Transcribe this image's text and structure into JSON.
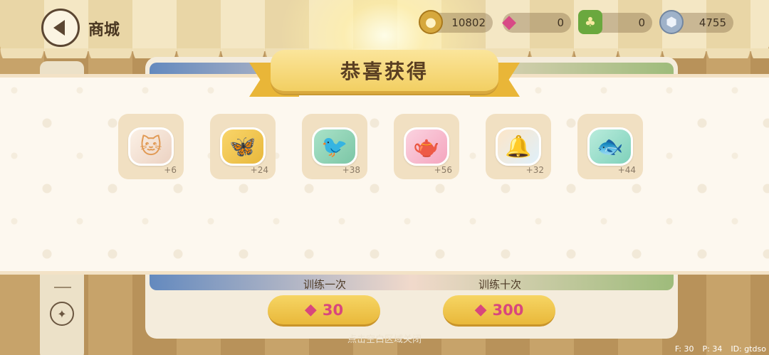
{
  "header": {
    "title": "商城",
    "back_icon": "back-arrow-icon"
  },
  "currencies": [
    {
      "name": "coin",
      "icon": "coin-icon",
      "value": "10802"
    },
    {
      "name": "gem",
      "icon": "gem-icon",
      "value": "0"
    },
    {
      "name": "acorn",
      "icon": "acorn-icon",
      "value": "0"
    },
    {
      "name": "medal",
      "icon": "medal-icon",
      "value": "4755"
    }
  ],
  "popup": {
    "title": "恭喜获得",
    "items": [
      {
        "name": "cat",
        "icon": "cat-icon",
        "glyph": "🐱",
        "qty": "+6"
      },
      {
        "name": "butterfly",
        "icon": "butterfly-icon",
        "glyph": "🦋",
        "qty": "+24"
      },
      {
        "name": "bird",
        "icon": "bird-icon",
        "glyph": "🐦",
        "qty": "+38"
      },
      {
        "name": "watering-can",
        "icon": "watering-can-icon",
        "glyph": "🫖",
        "qty": "+56"
      },
      {
        "name": "bell",
        "icon": "bell-icon",
        "glyph": "🔔",
        "qty": "+32"
      },
      {
        "name": "fish",
        "icon": "fish-icon",
        "glyph": "🐟",
        "qty": "+44"
      }
    ]
  },
  "training": {
    "once_label": "训练一次",
    "once_cost": "30",
    "ten_label": "训练十次",
    "ten_cost": "300",
    "cost_icon": "gem-icon"
  },
  "close_hint": "点击空白区域关闭",
  "debug": {
    "f": "F: 30",
    "p": "P: 34",
    "id": "ID: gtdso"
  },
  "colors": {
    "ribbon": "#f2cf62",
    "popup_bg": "#fdf8ef",
    "item_tile": "#f1e0c2",
    "cost_text": "#d8477d"
  }
}
